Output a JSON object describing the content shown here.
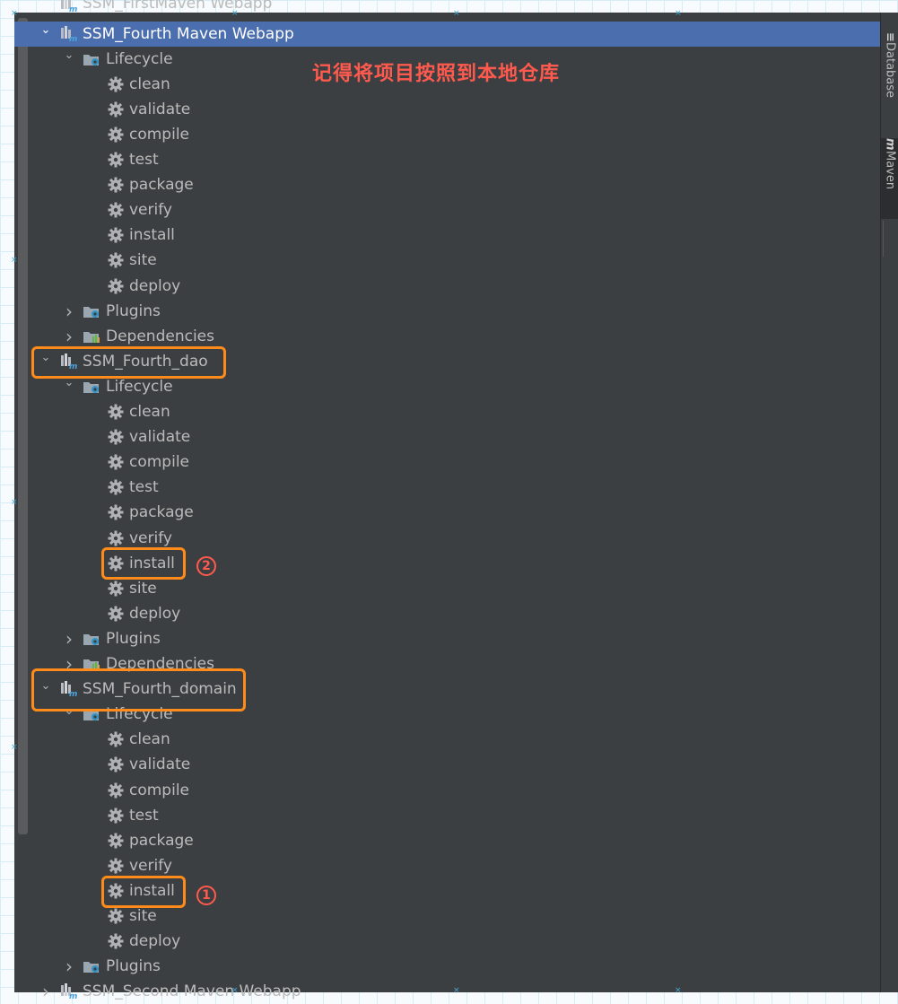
{
  "colors": {
    "panel_bg": "#3c3f41",
    "selection": "#4b6eaf",
    "highlight_box": "#ff8c1a",
    "annotation_text": "#ff5a4d"
  },
  "side_toolbar": {
    "database_label": "Database",
    "maven_label": "Maven"
  },
  "annotation": {
    "note": "记得将项目按照到本地仓库",
    "step1": "1",
    "step2": "2"
  },
  "tree": {
    "top_partial": "SSM_FirstMaven Webapp",
    "bottom_partial": "SSM_Second Maven Webapp",
    "projects": [
      {
        "name": "SSM_Fourth Maven Webapp",
        "lifecycle_label": "Lifecycle",
        "goals": [
          "clean",
          "validate",
          "compile",
          "test",
          "package",
          "verify",
          "install",
          "site",
          "deploy"
        ],
        "plugins_label": "Plugins",
        "dependencies_label": "Dependencies"
      },
      {
        "name": "SSM_Fourth_dao",
        "lifecycle_label": "Lifecycle",
        "goals": [
          "clean",
          "validate",
          "compile",
          "test",
          "package",
          "verify",
          "install",
          "site",
          "deploy"
        ],
        "plugins_label": "Plugins",
        "dependencies_label": "Dependencies"
      },
      {
        "name": "SSM_Fourth_domain",
        "lifecycle_label": "Lifecycle",
        "goals": [
          "clean",
          "validate",
          "compile",
          "test",
          "package",
          "verify",
          "install",
          "site",
          "deploy"
        ],
        "plugins_label": "Plugins"
      }
    ]
  }
}
